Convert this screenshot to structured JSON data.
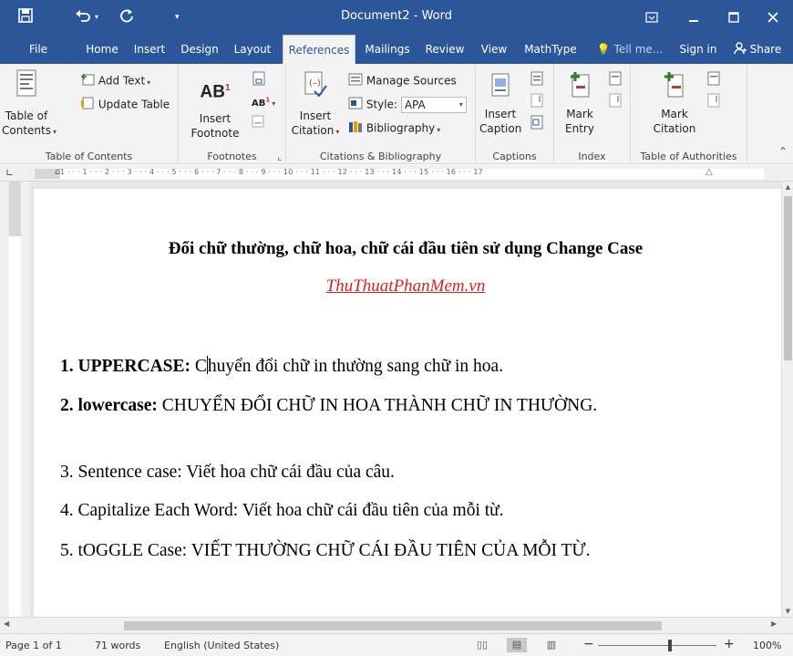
{
  "titlebar": {
    "title": "Document2 - Word",
    "save_icon": "save-icon",
    "undo_icon": "undo-icon",
    "redo_icon": "redo-icon",
    "qat_icon": "customize-qat-icon",
    "ribbon_display_icon": "ribbon-display-options-icon",
    "minimize_icon": "minimize-icon",
    "maximize_icon": "maximize-icon",
    "close_icon": "close-icon"
  },
  "tabs": [
    {
      "label": "File"
    },
    {
      "label": "Home"
    },
    {
      "label": "Insert"
    },
    {
      "label": "Design"
    },
    {
      "label": "Layout"
    },
    {
      "label": "References",
      "active": true
    },
    {
      "label": "Mailings"
    },
    {
      "label": "Review"
    },
    {
      "label": "View"
    },
    {
      "label": "MathType"
    }
  ],
  "tell_me": "Tell me...",
  "sign_in": "Sign in",
  "share": "Share",
  "ribbon": {
    "toc": {
      "table_of_contents_line1": "Table of",
      "table_of_contents_line2": "Contents",
      "add_text": "Add Text",
      "update_table": "Update Table",
      "group_label": "Table of Contents"
    },
    "footnotes": {
      "insert_footnote_line1": "Insert",
      "insert_footnote_line2": "Footnote",
      "ab_label": "AB",
      "ab_sup": "1",
      "next_footnote_label": "AB",
      "next_footnote_sup": "1",
      "group_label": "Footnotes"
    },
    "citations": {
      "insert_citation_line1": "Insert",
      "insert_citation_line2": "Citation",
      "manage_sources": "Manage Sources",
      "style_label": "Style:",
      "style_value": "APA",
      "bibliography": "Bibliography",
      "group_label": "Citations & Bibliography"
    },
    "captions": {
      "insert_caption_line1": "Insert",
      "insert_caption_line2": "Caption",
      "group_label": "Captions"
    },
    "index": {
      "mark_entry_line1": "Mark",
      "mark_entry_line2": "Entry",
      "group_label": "Index"
    },
    "authorities": {
      "mark_citation_line1": "Mark",
      "mark_citation_line2": "Citation",
      "group_label": "Table of Authorities"
    }
  },
  "ruler": {
    "marks": "1 · · · 1 · · · 2 · · · 3 · · · 4 · · · 5 · · · 6 · · · 7 · · · 8 · · · 9 · · · 10 · · · 11 · · · 12 · · · 13 · · · 14 · · · 15 · · · 16 · · · 17"
  },
  "document": {
    "title": "Đổi chữ thường, chữ hoa, chữ cái đầu tiên sử dụng Change Case",
    "link": "ThuThuatPhanMem.vn",
    "p1_bold": "1. UPPERCASE:",
    "p1_a": " C",
    "p1_b": "huyển đổi chữ in thường sang chữ in hoa.",
    "p2_bold": "2. lowercase:",
    "p2_text": " CHUYỂN ĐỔI CHỮ IN HOA THÀNH CHỮ IN THƯỜNG.",
    "p3": "3. Sentence case: Viết hoa chữ cái đầu của câu.",
    "p4": "4. Capitalize Each Word: Viết hoa chữ cái đầu tiên của mỗi từ.",
    "p5": "5. tOGGLE Case: VIẾT THƯỜNG CHỮ CÁI ĐẦU TIÊN CỦA MỖI TỪ."
  },
  "status": {
    "page": "Page 1 of 1",
    "words": "71 words",
    "language": "English (United States)",
    "zoom_minus": "−",
    "zoom_plus": "+",
    "zoom": "100%"
  }
}
